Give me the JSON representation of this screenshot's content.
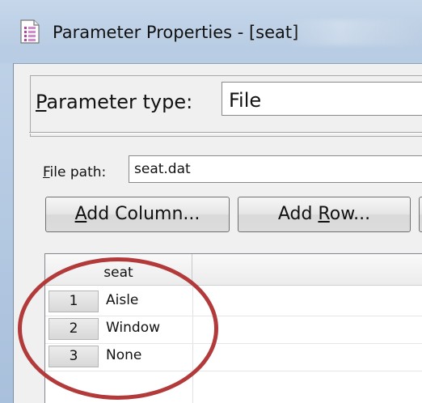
{
  "window": {
    "title": "Parameter Properties - [seat]",
    "icon": "document-parameter-icon"
  },
  "form": {
    "parameter_type_label_prefix": "P",
    "parameter_type_label_rest": "arameter type:",
    "parameter_type_value": "File",
    "file_path_label_prefix": "F",
    "file_path_label_rest": "ile path:",
    "file_path_value": "seat.dat"
  },
  "buttons": {
    "add_column_pre": "",
    "add_column_u": "A",
    "add_column_post": "dd Column...",
    "add_row_pre": "Add ",
    "add_row_u": "R",
    "add_row_post": "ow..."
  },
  "grid": {
    "column_header": "seat",
    "rows": [
      {
        "num": "1",
        "value": "Aisle"
      },
      {
        "num": "2",
        "value": "Window"
      },
      {
        "num": "3",
        "value": "None"
      }
    ]
  },
  "colors": {
    "annotation_ellipse": "#b33a3a",
    "titlebar": "#c6d7ea"
  }
}
